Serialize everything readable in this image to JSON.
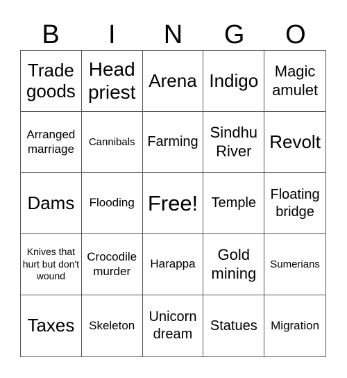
{
  "header": {
    "letters": [
      "B",
      "I",
      "N",
      "G",
      "O"
    ]
  },
  "cells": [
    "Trade goods",
    "Head priest",
    "Arena",
    "Indigo",
    "Magic amulet",
    "Arranged marriage",
    "Cannibals",
    "Farming",
    "Sindhu River",
    "Revolt",
    "Dams",
    "Flooding",
    "Free!",
    "Temple",
    "Floating bridge",
    "Knives that hurt but don't wound",
    "Crocodile murder",
    "Harappa",
    "Gold mining",
    "Sumerians",
    "Taxes",
    "Skeleton",
    "Unicorn dream",
    "Statues",
    "Migration"
  ]
}
